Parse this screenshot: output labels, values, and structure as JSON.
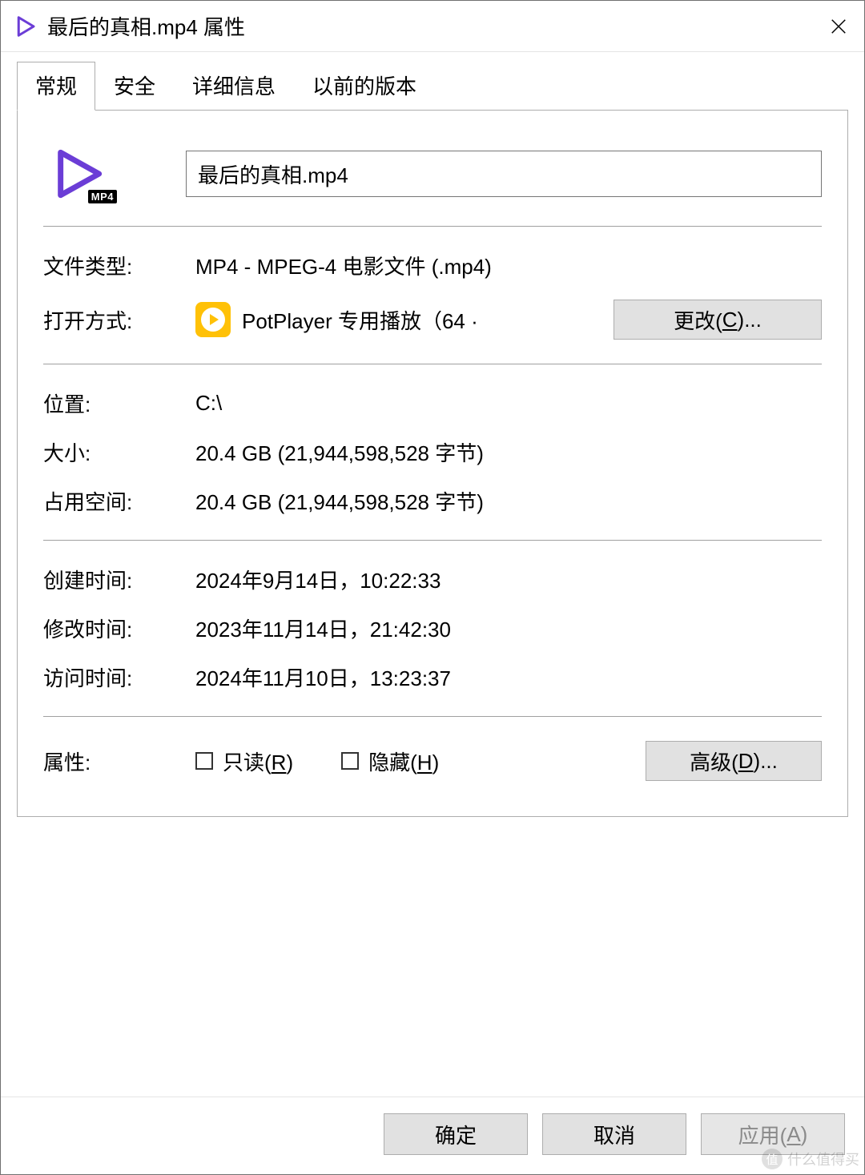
{
  "window": {
    "title": "最后的真相.mp4 属性",
    "icon_badge": "MP4"
  },
  "tabs": [
    "常规",
    "安全",
    "详细信息",
    "以前的版本"
  ],
  "active_tab": 0,
  "file": {
    "filename": "最后的真相.mp4",
    "icon_badge": "MP4"
  },
  "labels": {
    "file_type": "文件类型:",
    "opens_with": "打开方式:",
    "location": "位置:",
    "size": "大小:",
    "size_on_disk": "占用空间:",
    "created": "创建时间:",
    "modified": "修改时间:",
    "accessed": "访问时间:",
    "attributes": "属性:"
  },
  "values": {
    "file_type": "MP4 - MPEG-4 电影文件 (.mp4)",
    "opens_with": "PotPlayer 专用播放（64 ·",
    "location": "C:\\",
    "size": "20.4 GB (21,944,598,528 字节)",
    "size_on_disk": "20.4 GB (21,944,598,528 字节)",
    "created": "2024年9月14日，10:22:33",
    "modified": "2023年11月14日，21:42:30",
    "accessed": "2024年11月10日，13:23:37"
  },
  "buttons": {
    "change_prefix": "更改(",
    "change_key": "C",
    "change_suffix": ")...",
    "advanced_prefix": "高级(",
    "advanced_key": "D",
    "advanced_suffix": ")...",
    "ok": "确定",
    "cancel": "取消",
    "apply_prefix": "应用(",
    "apply_key": "A",
    "apply_suffix": ")"
  },
  "attributes": {
    "readonly_prefix": "只读(",
    "readonly_key": "R",
    "readonly_suffix": ")",
    "hidden_prefix": "隐藏(",
    "hidden_key": "H",
    "hidden_suffix": ")"
  },
  "watermark": "什么值得买"
}
